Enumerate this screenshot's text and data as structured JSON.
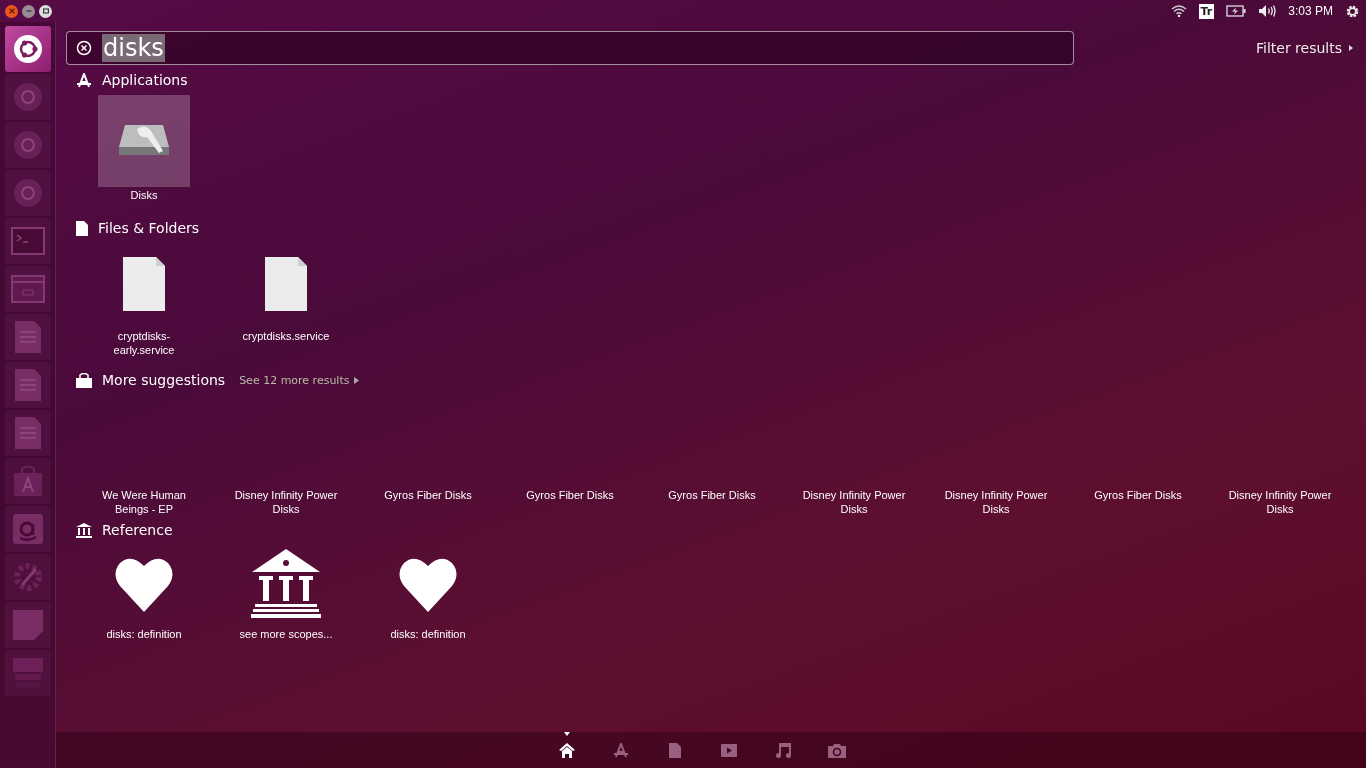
{
  "panel": {
    "keyboard_indicator": "Tr",
    "time": "3:03 PM"
  },
  "launcher": [
    {
      "kind": "dash",
      "selected": true
    },
    {
      "kind": "browser",
      "selected": false
    },
    {
      "kind": "sphere",
      "selected": false
    },
    {
      "kind": "fox",
      "selected": false
    },
    {
      "kind": "terminal",
      "selected": false
    },
    {
      "kind": "window",
      "selected": false
    },
    {
      "kind": "document",
      "selected": false
    },
    {
      "kind": "spreadsheet",
      "selected": false
    },
    {
      "kind": "presentation",
      "selected": false
    },
    {
      "kind": "store",
      "selected": false
    },
    {
      "kind": "amazon",
      "selected": false
    },
    {
      "kind": "settings",
      "selected": false
    },
    {
      "kind": "note",
      "selected": false
    },
    {
      "kind": "workspaces",
      "selected": false
    }
  ],
  "search": {
    "value": "disks"
  },
  "filter": {
    "label": "Filter results"
  },
  "sections": [
    {
      "kind": "applications",
      "heading": "Applications",
      "items": [
        {
          "kind": "disk",
          "label": "Disks",
          "selected": true
        }
      ]
    },
    {
      "kind": "files",
      "heading": "Files & Folders",
      "items": [
        {
          "kind": "file",
          "label": "cryptdisks-early.service",
          "selected": false
        },
        {
          "kind": "file",
          "label": "cryptdisks.service",
          "selected": false
        }
      ]
    },
    {
      "kind": "suggestions",
      "heading": "More suggestions",
      "more": "See 12 more results",
      "items": [
        {
          "kind": "blank",
          "label": "We Were Human Beings - EP",
          "selected": false
        },
        {
          "kind": "blank",
          "label": "Disney Infinity Power Disks",
          "selected": false
        },
        {
          "kind": "blank",
          "label": "Gyros Fiber Disks",
          "selected": false
        },
        {
          "kind": "blank",
          "label": "Gyros Fiber Disks",
          "selected": false
        },
        {
          "kind": "blank",
          "label": "Gyros Fiber Disks",
          "selected": false
        },
        {
          "kind": "blank",
          "label": "Disney Infinity Power Disks",
          "selected": false
        },
        {
          "kind": "blank",
          "label": "Disney Infinity Power Disks",
          "selected": false
        },
        {
          "kind": "blank",
          "label": "Gyros Fiber Disks",
          "selected": false
        },
        {
          "kind": "blank",
          "label": "Disney Infinity Power Disks",
          "selected": false
        }
      ]
    },
    {
      "kind": "reference",
      "heading": "Reference",
      "items": [
        {
          "kind": "heart",
          "label": "disks: definition",
          "selected": false
        },
        {
          "kind": "temple",
          "label": "see more scopes...",
          "selected": false
        },
        {
          "kind": "heart",
          "label": "disks: definition",
          "selected": false
        }
      ]
    }
  ],
  "scopes": [
    {
      "kind": "home",
      "selected": true
    },
    {
      "kind": "apps",
      "selected": false
    },
    {
      "kind": "files",
      "selected": false
    },
    {
      "kind": "video",
      "selected": false
    },
    {
      "kind": "music",
      "selected": false
    },
    {
      "kind": "photos",
      "selected": false
    }
  ]
}
